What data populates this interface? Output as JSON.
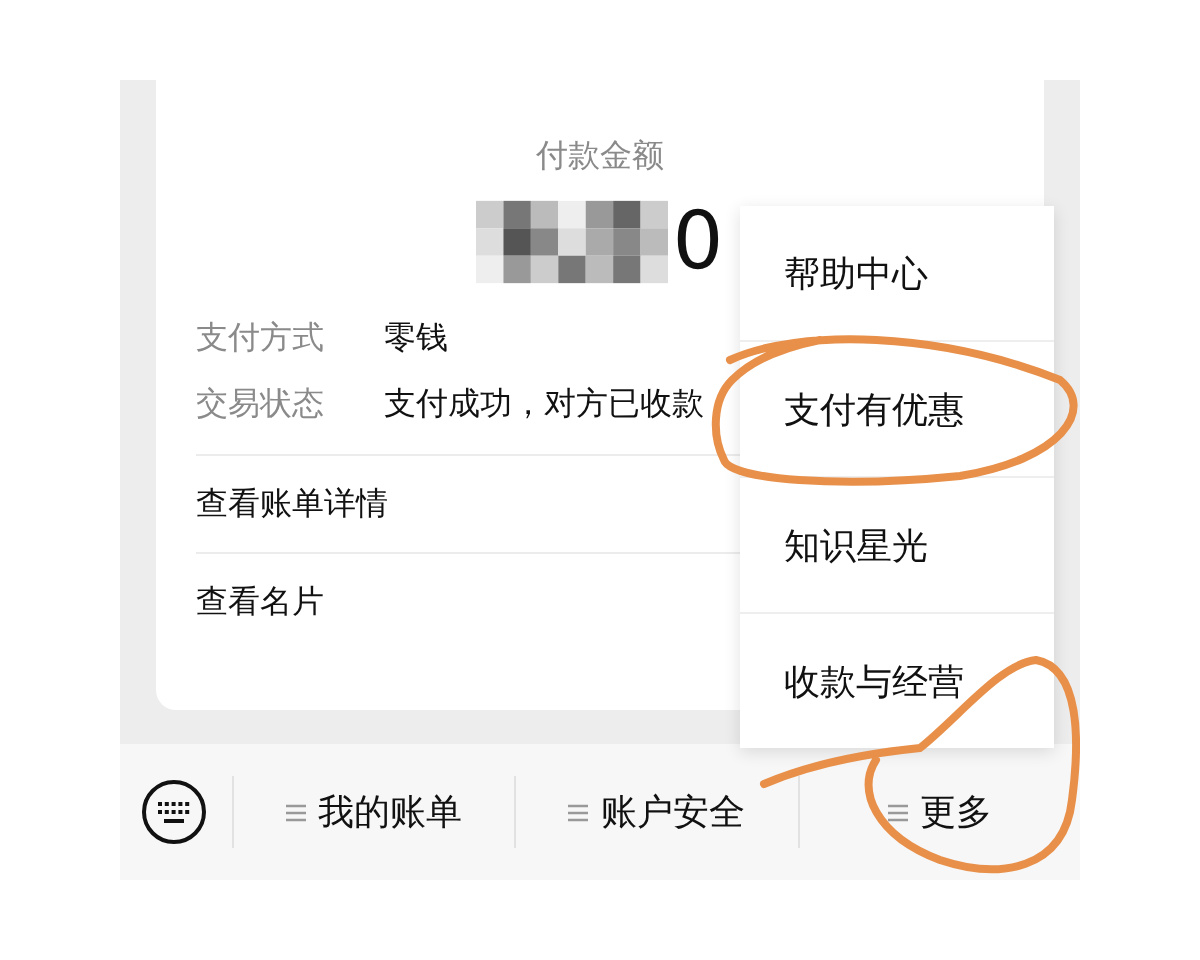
{
  "card": {
    "title": "付款金额",
    "amount": "0",
    "details": [
      {
        "label": "支付方式",
        "value": "零钱"
      },
      {
        "label": "交易状态",
        "value": "支付成功，对方已收款"
      }
    ],
    "links": [
      "查看账单详情",
      "查看名片"
    ]
  },
  "menu": {
    "items": [
      "帮助中心",
      "支付有优惠",
      "知识星光",
      "收款与经营"
    ]
  },
  "bottom_bar": {
    "items": [
      "我的账单",
      "账户安全",
      "更多"
    ]
  }
}
